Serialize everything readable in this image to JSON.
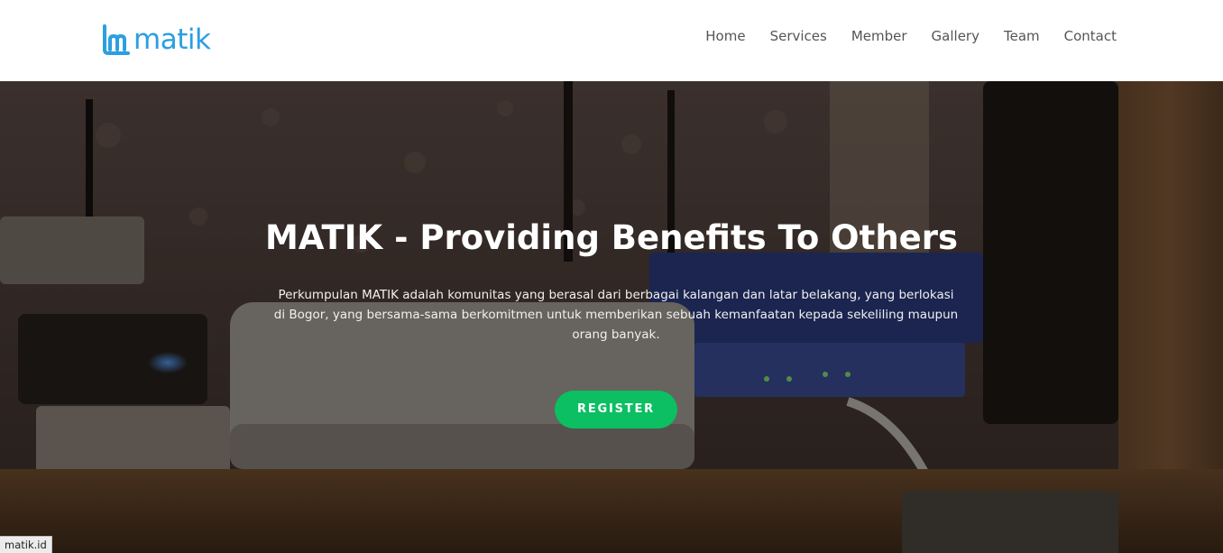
{
  "brand": {
    "logo_text": "matik",
    "logo_color": "#2b9fe0"
  },
  "nav": {
    "items": [
      {
        "label": "Home"
      },
      {
        "label": "Services"
      },
      {
        "label": "Member"
      },
      {
        "label": "Gallery"
      },
      {
        "label": "Team"
      },
      {
        "label": "Contact"
      }
    ]
  },
  "hero": {
    "title": "MATIK - Providing Benefits To Others",
    "description": "Perkumpulan MATIK adalah komunitas yang berasal dari berbagai kalangan dan latar belakang, yang berlokasi di Bogor, yang bersama-sama berkomitmen untuk memberikan sebuah kemanfaatan kepada sekeliling maupun orang banyak.",
    "button_label": "REGISTER",
    "button_color": "#0bbf62"
  },
  "status_bar": {
    "url": "matik.id"
  }
}
